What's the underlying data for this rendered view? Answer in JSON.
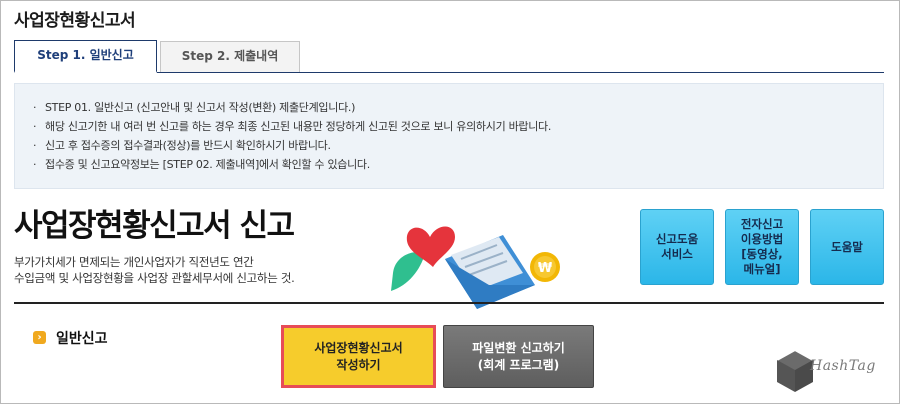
{
  "page": {
    "title": "사업장현황신고서"
  },
  "tabs": [
    {
      "label": "Step 1. 일반신고",
      "active": true
    },
    {
      "label": "Step 2. 제출내역",
      "active": false
    }
  ],
  "notice": {
    "items": [
      "STEP 01. 일반신고 (신고안내 및 신고서 작성(변환) 제출단계입니다.)",
      "해당 신고기한 내 여러 번 신고를 하는 경우 최종 신고된 내용만 정당하게 신고된 것으로 보니 유의하시기 바랍니다.",
      "신고 후 접수증의 접수결과(정상)를 반드시 확인하시기 바랍니다.",
      "접수증 및 신고요약정보는 [STEP 02. 제출내역]에서 확인할 수 있습니다."
    ]
  },
  "hero": {
    "title": "사업장현황신고서 신고",
    "desc_line1": "부가가치세가 면제되는 개인사업자가 직전년도 연간",
    "desc_line2": "수입금액 및 사업장현황을 사업장 관할세무서에 신고하는 것."
  },
  "quick_buttons": [
    {
      "label": "신고도움\n서비스"
    },
    {
      "label": "전자신고\n이용방법\n[동영상,\n메뉴얼]"
    },
    {
      "label": "도움말"
    }
  ],
  "section": {
    "label": "일반신고"
  },
  "actions": {
    "write_label": "사업장현황신고서\n작성하기",
    "convert_label": "파일변환 신고하기\n(회계 프로그램)"
  },
  "watermark": {
    "text": "HashTag",
    "badge_text": "Hash Tag"
  },
  "colors": {
    "accent_blue": "#1e3a6b",
    "quick_btn": "#2bb6e8",
    "primary_btn": "#f6cc2c",
    "highlight_border": "#e74c57",
    "secondary_btn": "#666666"
  }
}
